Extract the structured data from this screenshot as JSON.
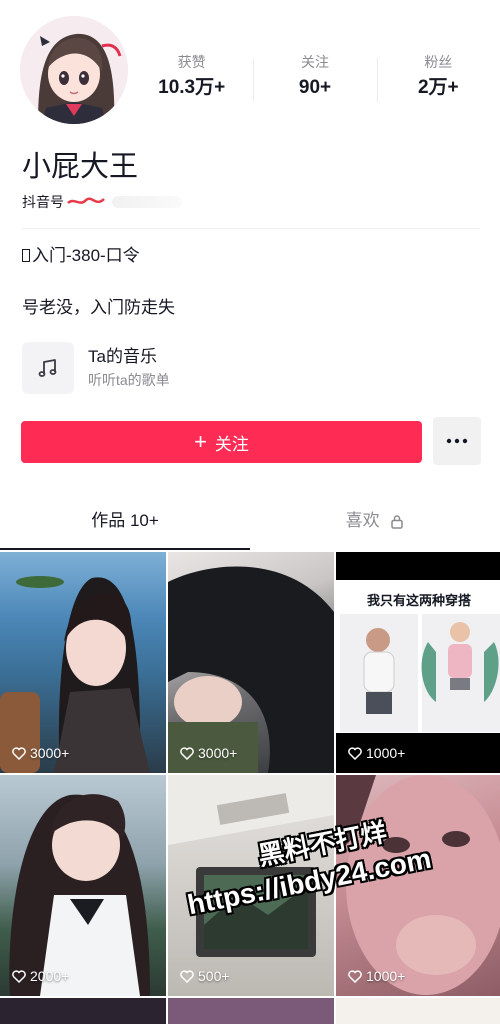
{
  "profile": {
    "nickname": "小屁大王",
    "douyin_id_label": "抖音号",
    "stats": [
      {
        "label": "获赞",
        "value": "10.3万+"
      },
      {
        "label": "关注",
        "value": "90+"
      },
      {
        "label": "粉丝",
        "value": "2万+"
      }
    ],
    "bio_line1": "入门-380-口令",
    "bio_line2": "号老没，入门防走失"
  },
  "music": {
    "title": "Ta的音乐",
    "subtitle": "听听ta的歌单",
    "icon": "music-note-icon"
  },
  "actions": {
    "follow_label": "关注",
    "follow_icon": "plus-icon",
    "more_icon": "more-dots-icon"
  },
  "tabs": [
    {
      "label": "作品 10+",
      "active": true
    },
    {
      "label": "喜欢",
      "active": false,
      "icon": "lock-icon"
    }
  ],
  "videos": [
    {
      "likes": "3000+"
    },
    {
      "likes": "3000+"
    },
    {
      "likes": "1000+",
      "overlay_text": "我只有这两种穿搭"
    },
    {
      "likes": "2000+"
    },
    {
      "likes": "500+"
    },
    {
      "likes": "1000+"
    }
  ],
  "watermark": {
    "line1": "黑料不打烊",
    "line2": "https://ibdy24.com"
  },
  "colors": {
    "accent": "#fe2c55",
    "text_primary": "#161823",
    "text_secondary": "#8a8b91"
  }
}
